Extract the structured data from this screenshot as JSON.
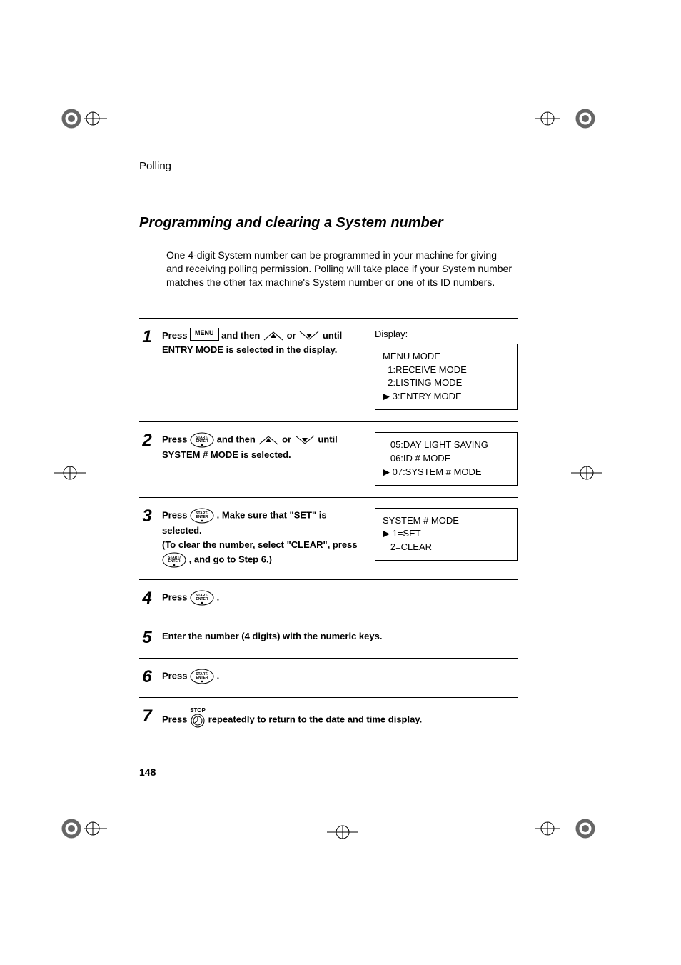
{
  "running_head": "Polling",
  "section_title": "Programming and clearing a System number",
  "intro": "One 4-digit System number can be programmed in your machine for giving and receiving polling permission. Polling will take place if your System number matches the other fax machine's System number or one of its ID numbers.",
  "keys": {
    "menu": "MENU",
    "start_enter": "START/\nENTER",
    "stop": "STOP"
  },
  "steps": [
    {
      "num": "1",
      "text_pre": "Press ",
      "text_mid": " and then ",
      "text_or": " or ",
      "text_post": " until ENTRY MODE is selected in the display.",
      "display_label": "Display:",
      "display": "MENU MODE\n  1:RECEIVE MODE\n  2:LISTING MODE\n▶ 3:ENTRY MODE"
    },
    {
      "num": "2",
      "text_pre": "Press ",
      "text_mid": " and then ",
      "text_or": " or ",
      "text_post": " until SYSTEM # MODE is selected.",
      "display": "   05:DAY LIGHT SAVING\n   06:ID # MODE\n▶ 07:SYSTEM # MODE"
    },
    {
      "num": "3",
      "text_pre": "Press ",
      "text_a": ". Make sure that \"SET\" is selected.",
      "text_b": "(To clear the number, select \"CLEAR\", press ",
      "text_c": ", and go to Step 6.)",
      "display": "SYSTEM # MODE\n▶ 1=SET\n   2=CLEAR"
    },
    {
      "num": "4",
      "text_pre": "Press ",
      "text_post": "."
    },
    {
      "num": "5",
      "text": "Enter the number (4 digits) with the numeric keys."
    },
    {
      "num": "6",
      "text_pre": "Press ",
      "text_post": " ."
    },
    {
      "num": "7",
      "text_pre": "Press ",
      "text_post": " repeatedly to return to the date and time display."
    }
  ],
  "page_number": "148"
}
